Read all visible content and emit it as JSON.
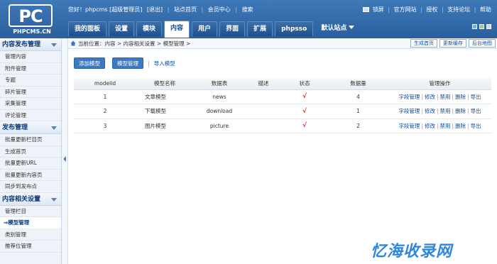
{
  "logo": {
    "mark": "PC",
    "text": "PHPCMS.CN"
  },
  "topbar": {
    "greeting": "您好！phpcms [超级管理员]",
    "logout": "[退出]",
    "site_home": "站点首页",
    "member_center": "会员中心",
    "search": "搜索",
    "lock": "锁屏",
    "official_site": "官方网站",
    "license": "授权",
    "forum": "支持论坛",
    "help": "帮助"
  },
  "nav": {
    "tabs": [
      "我的面板",
      "设置",
      "模块",
      "内容",
      "用户",
      "界面",
      "扩展",
      "phpsso"
    ],
    "active_index": 3,
    "site_switch": "默认站点"
  },
  "sidebar": {
    "sections": [
      {
        "title": "内容发布管理",
        "items": [
          "管理内容",
          "附件管理",
          "专题",
          "碎片管理",
          "采集管理",
          "评论管理"
        ]
      },
      {
        "title": "发布管理",
        "items": [
          "批量更新栏目页",
          "生成首页",
          "批量更新URL",
          "批量更新内容页",
          "同步到发布点"
        ]
      },
      {
        "title": "内容相关设置",
        "items": [
          "管理栏目",
          "模型管理",
          "类别管理",
          "推荐位管理"
        ]
      }
    ],
    "active_item": "模型管理",
    "active_prefix": "⇒"
  },
  "breadcrumb": "当前位置：内容 > 内容相关设置 > 模型管理 >",
  "crumb_actions": [
    "生成首页",
    "更新缓存",
    "后台地图"
  ],
  "subnav": {
    "add": "添加模型",
    "manage": "模型管理",
    "import": "导入模型"
  },
  "table": {
    "headers": [
      "modelid",
      "模型名称",
      "数据表",
      "描述",
      "状态",
      "数据量",
      "管理操作"
    ],
    "rows": [
      {
        "id": "1",
        "name": "文章模型",
        "table": "news",
        "desc": "",
        "status": "√",
        "count": "4"
      },
      {
        "id": "2",
        "name": "下载模型",
        "table": "download",
        "desc": "",
        "status": "√",
        "count": "1"
      },
      {
        "id": "3",
        "name": "图片模型",
        "table": "picture",
        "desc": "",
        "status": "√",
        "count": "2"
      }
    ],
    "ops": [
      "字段管理",
      "修改",
      "禁用",
      "删除",
      "导出"
    ]
  },
  "watermark": "忆海收录网"
}
